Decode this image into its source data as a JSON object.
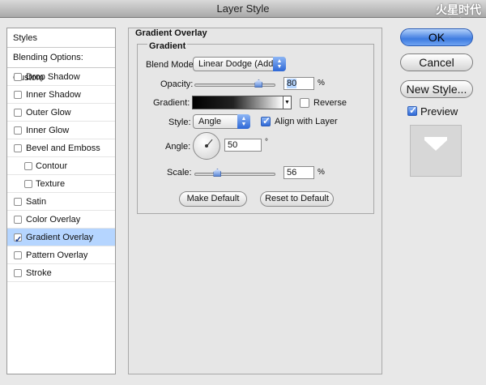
{
  "window": {
    "title": "Layer Style"
  },
  "watermark": {
    "text": "火星时代",
    "url": "www.hxsd.com.cn"
  },
  "styles_panel": {
    "header": "Styles",
    "blending_options": "Blending Options: Custom",
    "items": [
      {
        "label": "Drop Shadow",
        "checked": false,
        "sub": false,
        "selected": false
      },
      {
        "label": "Inner Shadow",
        "checked": false,
        "sub": false,
        "selected": false
      },
      {
        "label": "Outer Glow",
        "checked": false,
        "sub": false,
        "selected": false
      },
      {
        "label": "Inner Glow",
        "checked": false,
        "sub": false,
        "selected": false
      },
      {
        "label": "Bevel and Emboss",
        "checked": false,
        "sub": false,
        "selected": false
      },
      {
        "label": "Contour",
        "checked": false,
        "sub": true,
        "selected": false
      },
      {
        "label": "Texture",
        "checked": false,
        "sub": true,
        "selected": false
      },
      {
        "label": "Satin",
        "checked": false,
        "sub": false,
        "selected": false
      },
      {
        "label": "Color Overlay",
        "checked": false,
        "sub": false,
        "selected": false
      },
      {
        "label": "Gradient Overlay",
        "checked": true,
        "sub": false,
        "selected": true
      },
      {
        "label": "Pattern Overlay",
        "checked": false,
        "sub": false,
        "selected": false
      },
      {
        "label": "Stroke",
        "checked": false,
        "sub": false,
        "selected": false
      }
    ]
  },
  "gradient_overlay": {
    "group_title": "Gradient Overlay",
    "inner_title": "Gradient",
    "blend_mode_label": "Blend Mode:",
    "blend_mode_value": "Linear Dodge (Add)",
    "opacity_label": "Opacity:",
    "opacity_value": "80",
    "opacity_fraction": 0.8,
    "percent": "%",
    "gradient_label": "Gradient:",
    "reverse_label": "Reverse",
    "reverse_checked": false,
    "style_label": "Style:",
    "style_value": "Angle",
    "align_label": "Align with Layer",
    "align_checked": true,
    "angle_label": "Angle:",
    "angle_value": "50",
    "degree": "°",
    "scale_label": "Scale:",
    "scale_value": "56",
    "scale_fraction": 0.28,
    "make_default": "Make Default",
    "reset_default": "Reset to Default"
  },
  "actions": {
    "ok": "OK",
    "cancel": "Cancel",
    "new_style": "New Style...",
    "preview_label": "Preview",
    "preview_checked": true
  }
}
